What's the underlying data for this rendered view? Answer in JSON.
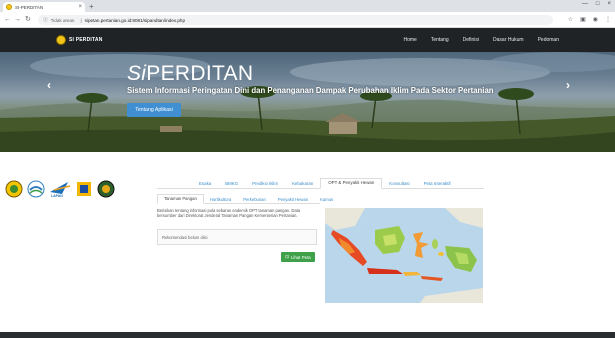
{
  "browser": {
    "tab_title": "SI-PERDITAN",
    "tab_close": "×",
    "new_tab": "+",
    "secure_label": "Tidak aman",
    "url": "sipetan.pertanian.go.id:8081/sipandtan/index.php",
    "win_controls": [
      "—",
      "□",
      "×"
    ]
  },
  "site": {
    "brand": "SI PERDITAN",
    "menu": [
      "Home",
      "Tentang",
      "Definisi",
      "Dasar Hukum",
      "Pedoman"
    ]
  },
  "hero": {
    "title_prefix": "Si",
    "title_main": "PERDITAN",
    "subtitle": "Sistem Informasi Peringatan Dini dan Penanganan Dampak Perubahan Iklim Pada Sektor Pertanian",
    "button": "Tentang Aplikasi",
    "prev": "‹",
    "next": "›"
  },
  "partners": {
    "lapan_text": "LAPAN"
  },
  "main_tabs": [
    {
      "label": "Esaka",
      "active": false
    },
    {
      "label": "BMKG",
      "active": false
    },
    {
      "label": "Prediksi Iklim",
      "active": false
    },
    {
      "label": "Kebakaran",
      "active": false
    },
    {
      "label": "OPT & Penyakit Hewan",
      "active": true
    },
    {
      "label": "Konsultasi",
      "active": false
    },
    {
      "label": "Peta Interaktif",
      "active": false
    }
  ],
  "sub_tabs": [
    {
      "label": "Tanaman Pangan",
      "active": true
    },
    {
      "label": "Hortikultura",
      "active": false
    },
    {
      "label": "Perkebunan",
      "active": false
    },
    {
      "label": "Penyakit Hewan",
      "active": false
    },
    {
      "label": "Kamus",
      "active": false
    }
  ],
  "content": {
    "info_text": "Berisikan tentang informasi pola sebaran endemik OPT tanaman pangan. Data bersumber dari Direktorat Jenderal Tanaman Pangan Kementerian Pertanian.",
    "recommendation": "Rekomendasi belum diisi",
    "map_button": "Lihat Peta"
  },
  "colors": {
    "navbar": "#1f2326",
    "link": "#3a8dc9",
    "hero_button": "#3f8fd2",
    "map_button": "#3ea14a"
  }
}
